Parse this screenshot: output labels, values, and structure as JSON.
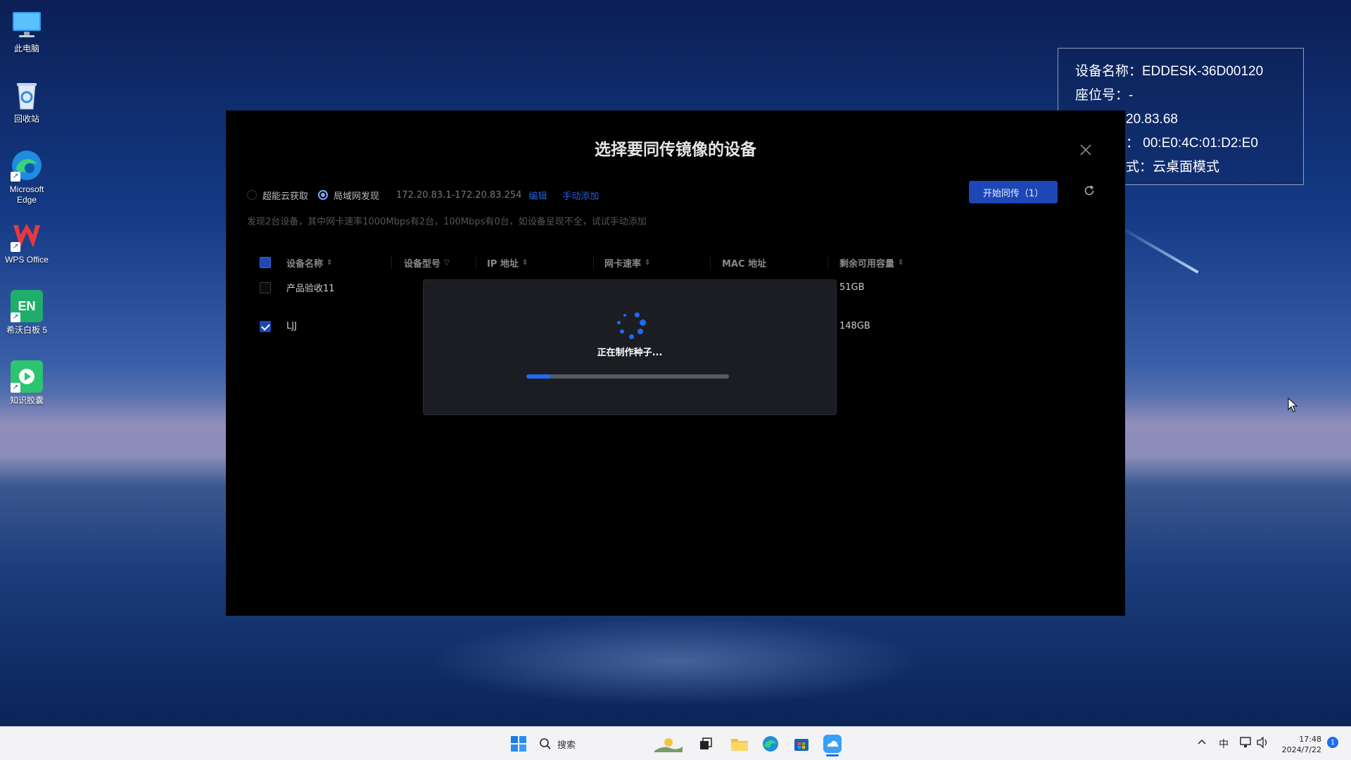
{
  "desktop": {
    "icons": [
      {
        "label": "此电脑",
        "icon": "computer-icon"
      },
      {
        "label": "回收站",
        "icon": "recycle-bin-icon"
      },
      {
        "label": "Microsoft Edge",
        "icon": "edge-icon"
      },
      {
        "label": "WPS Office",
        "icon": "wps-icon"
      },
      {
        "label": "希沃白板 5",
        "icon": "easinote-icon"
      },
      {
        "label": "知识胶囊",
        "icon": "knowledge-capsule-icon"
      }
    ]
  },
  "info_panel": {
    "lines": [
      "设备名称：EDDESK-36D00120",
      "座位号：-",
      "20.83.68",
      "：  00:E0:4C:01:D2:E0",
      "式：云桌面模式"
    ]
  },
  "dialog": {
    "title": "选择要同传镜像的设备",
    "radio_cloud": "超能云获取",
    "radio_lan": "局域网发现",
    "ip_range": "172.20.83.1-172.20.83.254",
    "edit_link": "编辑",
    "manual_add_link": "手动添加",
    "start_button": "开始同传（1）",
    "hint": "发现2台设备，其中网卡速率1000Mbps有2台，100Mbps有0台，如设备呈现不全，试试手动添加",
    "columns": [
      "设备名称",
      "设备型号",
      "IP 地址",
      "网卡速率",
      "MAC 地址",
      "剩余可用容量"
    ],
    "rows": [
      {
        "name": "产品验收11",
        "capacity": "51GB",
        "checked": false
      },
      {
        "name": "LJJ",
        "capacity": "148GB",
        "checked": true
      }
    ]
  },
  "progress": {
    "label": "正在制作种子...",
    "percent": 12,
    "accent": "#1e6cf0"
  },
  "taskbar": {
    "search_placeholder": "搜索",
    "ime": "中",
    "time": "17:48",
    "date": "2024/7/22",
    "notification_count": "1"
  }
}
